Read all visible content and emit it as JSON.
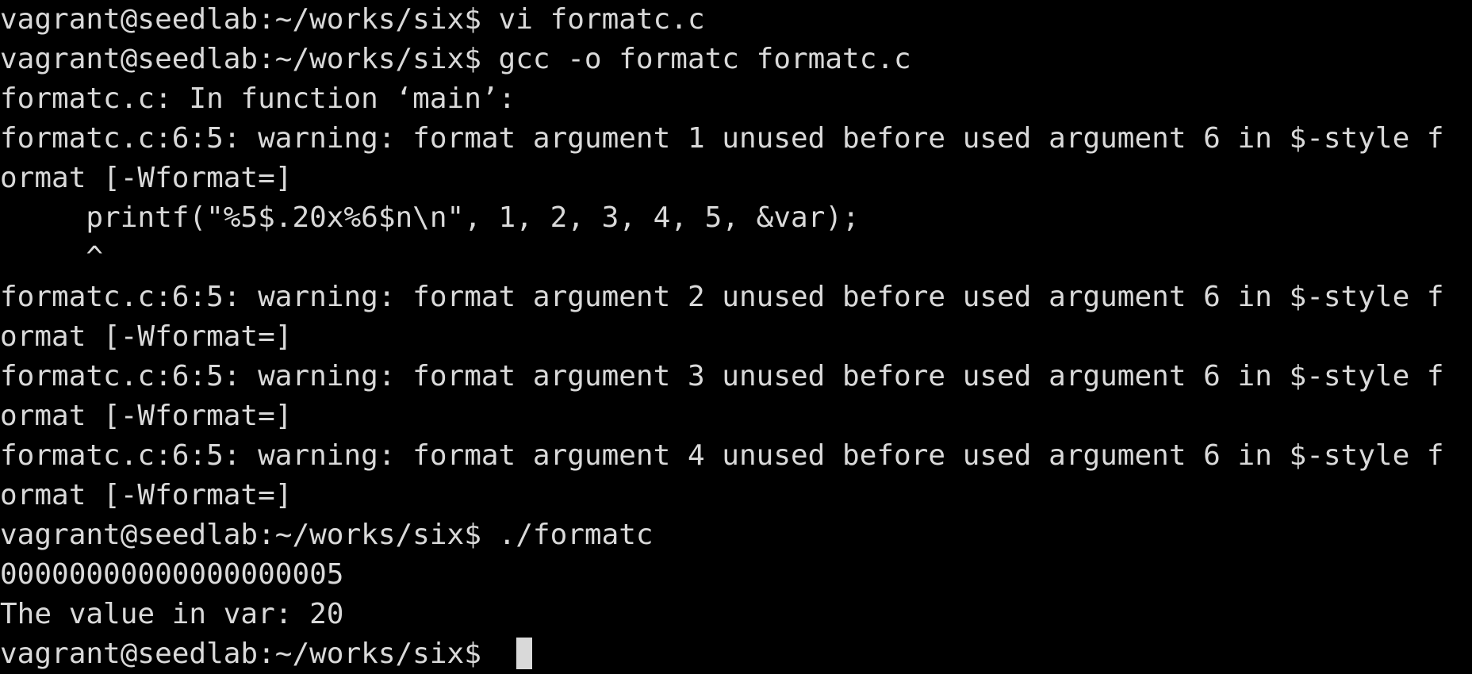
{
  "terminal": {
    "colors": {
      "background": "#000000",
      "foreground": "#d9d9d9"
    },
    "lines": [
      "vagrant@seedlab:~/works/six$ vi formatc.c",
      "vagrant@seedlab:~/works/six$ gcc -o formatc formatc.c",
      "formatc.c: In function ‘main’:",
      "formatc.c:6:5: warning: format argument 1 unused before used argument 6 in $-style f",
      "ormat [-Wformat=]",
      "     printf(\"%5$.20x%6$n\\n\", 1, 2, 3, 4, 5, &var);",
      "     ^",
      "formatc.c:6:5: warning: format argument 2 unused before used argument 6 in $-style f",
      "ormat [-Wformat=]",
      "formatc.c:6:5: warning: format argument 3 unused before used argument 6 in $-style f",
      "ormat [-Wformat=]",
      "formatc.c:6:5: warning: format argument 4 unused before used argument 6 in $-style f",
      "ormat [-Wformat=]",
      "vagrant@seedlab:~/works/six$ ./formatc",
      "00000000000000000005",
      "The value in var: 20"
    ],
    "prompt": "vagrant@seedlab:~/works/six$ "
  }
}
